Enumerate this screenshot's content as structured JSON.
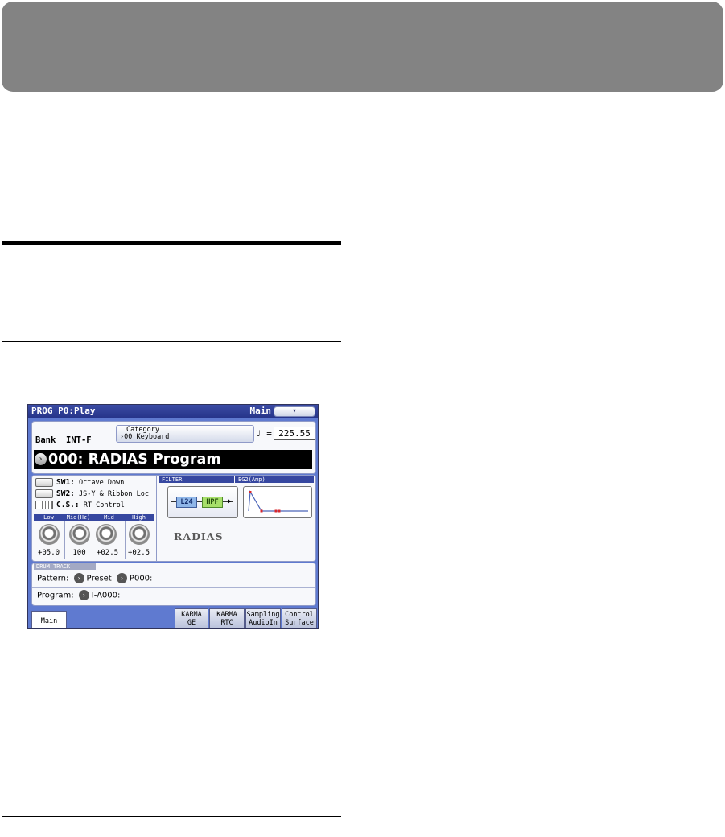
{
  "screen": {
    "mode": "PROG",
    "page": "P0:Play",
    "page_tab": "Main",
    "menu_icon": "chevron-down-icon",
    "menu_glyph": "▾",
    "bank_label": "Bank",
    "bank_value": "INT-F",
    "category_title": "Category",
    "category_value": "00 Keyboard",
    "category_arrow": "›",
    "tempo_symbol": "♩ =",
    "tempo_value": "225.55",
    "program_arrow": "›",
    "program_name": "000: RADIAS Program",
    "sw1_key": "SW1:",
    "sw1_value": "Octave Down",
    "sw2_key": "SW2:",
    "sw2_value": "JS-Y & Ribbon Loc",
    "cs_key": "C.S.:",
    "cs_value": "RT Control",
    "eq_labels": [
      "Low",
      "Mid(Hz)",
      "Mid",
      "High"
    ],
    "eq_values": [
      "+05.0",
      "100",
      "+02.5",
      "+02.5"
    ],
    "filter_label": "FILTER",
    "filter_l24": "L24",
    "filter_hpf": "HPF",
    "eg_label": "EG2(Amp)",
    "radias_logo": "RADIAS",
    "drum_label": "DRUM TRACK",
    "pattern_label": "Pattern:",
    "pattern_source": "Preset",
    "pattern_value": "P000:",
    "program_label": "Program:",
    "program_value": "I-A000:",
    "arrow_glyph": "›",
    "tabs": [
      "Main",
      "KARMA GE",
      "KARMA RTC",
      "Sampling AudioIn",
      "Control Surface"
    ],
    "tabs_lines": [
      [
        "Main"
      ],
      [
        "KARMA",
        "GE"
      ],
      [
        "KARMA",
        "RTC"
      ],
      [
        "Sampling",
        "AudioIn"
      ],
      [
        "Control",
        "Surface"
      ]
    ],
    "colors": {
      "title_bar": "#26348a",
      "body_blue": "#5f7ad0",
      "header_band": "#838383"
    }
  }
}
